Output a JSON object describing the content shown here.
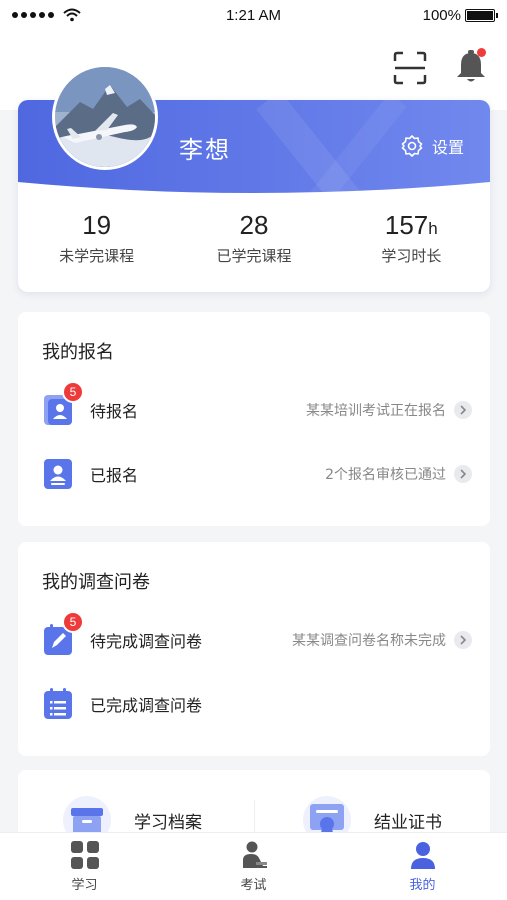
{
  "status_bar": {
    "time": "1:21 AM",
    "battery": "100%",
    "battery_level": 1.0
  },
  "header": {
    "scan_icon": "scan-icon",
    "bell_icon": "bell-icon",
    "has_notification": true
  },
  "profile": {
    "name": "李想",
    "settings_label": "设置",
    "stats": [
      {
        "value": "19",
        "unit": "",
        "label": "未学完课程"
      },
      {
        "value": "28",
        "unit": "",
        "label": "已学完课程"
      },
      {
        "value": "157",
        "unit": "h",
        "label": "学习时长"
      }
    ]
  },
  "registration": {
    "title": "我的报名",
    "items": [
      {
        "label": "待报名",
        "info": "某某培训考试正在报名",
        "badge": "5"
      },
      {
        "label": "已报名",
        "info": "2个报名审核已通过"
      }
    ]
  },
  "survey": {
    "title": "我的调查问卷",
    "items": [
      {
        "label": "待完成调查问卷",
        "info": "某某调查问卷名称未完成",
        "badge": "5"
      },
      {
        "label": "已完成调查问卷"
      }
    ]
  },
  "shortcuts": [
    {
      "label": "学习档案",
      "icon": "archive-box-icon"
    },
    {
      "label": "结业证书",
      "icon": "certificate-icon"
    }
  ],
  "tabbar": {
    "tabs": [
      {
        "label": "学习",
        "icon": "grid-icon"
      },
      {
        "label": "考试",
        "icon": "exam-person-icon"
      },
      {
        "label": "我的",
        "icon": "user-icon"
      }
    ],
    "active_tab": "我的"
  },
  "colors": {
    "accent": "#4a62e0",
    "banner": "#5b75e6",
    "badge": "#ee3a3a"
  }
}
